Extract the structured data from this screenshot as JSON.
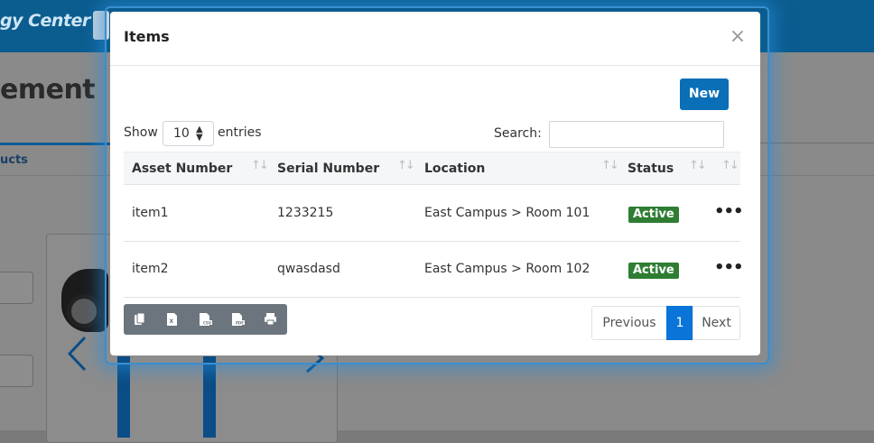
{
  "background": {
    "brand": "gy Center",
    "heading": "ement",
    "tab": "ucts"
  },
  "modal": {
    "title": "Items",
    "close_glyph": "×",
    "new_label": "New",
    "show_label": "Show",
    "page_size": "10",
    "entries_label": "entries",
    "search_label": "Search:",
    "search_value": "",
    "columns": [
      "Asset Number",
      "Serial Number",
      "Location",
      "Status"
    ],
    "rows": [
      {
        "asset": "item1",
        "serial": "1233215",
        "location": "East Campus > Room 101",
        "status": "Active"
      },
      {
        "asset": "item2",
        "serial": "qwasdasd",
        "location": "East Campus > Room 102",
        "status": "Active"
      }
    ],
    "row_menu_glyph": "•••",
    "export_icons": [
      "copy-icon",
      "excel-icon",
      "csv-icon",
      "pdf-icon",
      "print-icon"
    ],
    "pagination": {
      "previous": "Previous",
      "current": "1",
      "next": "Next"
    }
  },
  "colors": {
    "primary": "#0a6fb6",
    "active_badge": "#2f7d33",
    "export_group": "#6c757d",
    "current_page": "#0a74d8"
  }
}
